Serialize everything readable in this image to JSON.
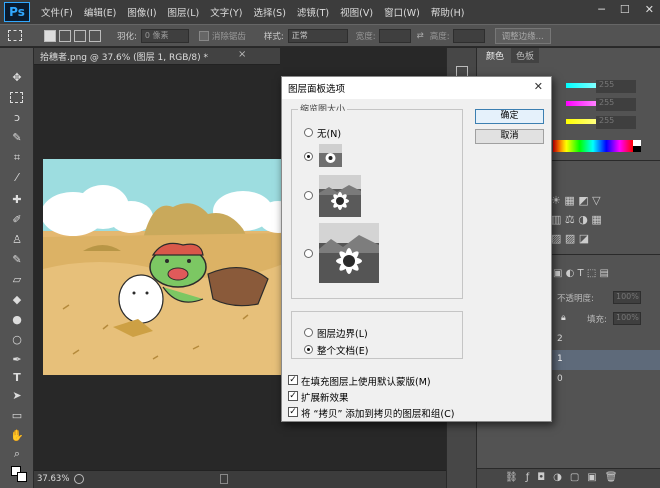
{
  "app": {
    "logo": "Ps"
  },
  "menu": [
    "文件(F)",
    "编辑(E)",
    "图像(I)",
    "图层(L)",
    "文字(Y)",
    "选择(S)",
    "滤镜(T)",
    "视图(V)",
    "窗口(W)",
    "帮助(H)"
  ],
  "window_controls": {
    "minimize": "─",
    "maximize": "☐",
    "close": "✕"
  },
  "options_bar": {
    "feather_label": "羽化:",
    "feather_value": "0 像素",
    "antialias_label": "消除锯齿",
    "style_label": "样式:",
    "style_value": "正常",
    "width_label": "宽度:",
    "height_label": "高度:",
    "refine_button": "调整边缘..."
  },
  "document": {
    "tab_title": "拾穗者.png @ 37.6% (图层 1, RGB/8) *",
    "zoom": "37.63%"
  },
  "right_panel": {
    "tabs": [
      "颜色",
      "色板"
    ],
    "rgb_values": [
      "255",
      "255",
      "255"
    ],
    "blend_partial": "不透明度:",
    "opacity_value": "100%",
    "fill_label": "填充:",
    "fill_value": "100%",
    "layer_numbers": [
      "2",
      "1",
      "0"
    ]
  },
  "dialog": {
    "title": "图层面板选项",
    "thumb_group_label": "缩览图大小",
    "option_none": "无(N)",
    "layer_bounds": "图层边界(L)",
    "entire_document": "整个文档(E)",
    "use_default_masks": "在填充图层上使用默认蒙版(M)",
    "expand_new_effects": "扩展新效果",
    "add_copy": "将 “拷贝” 添加到拷贝的图层和组(C)",
    "ok": "确定",
    "cancel": "取消"
  },
  "colors": {
    "ps_blue": "#31a8ff",
    "dialog_bg": "#f0f0f0",
    "panel_bg": "#535353"
  }
}
